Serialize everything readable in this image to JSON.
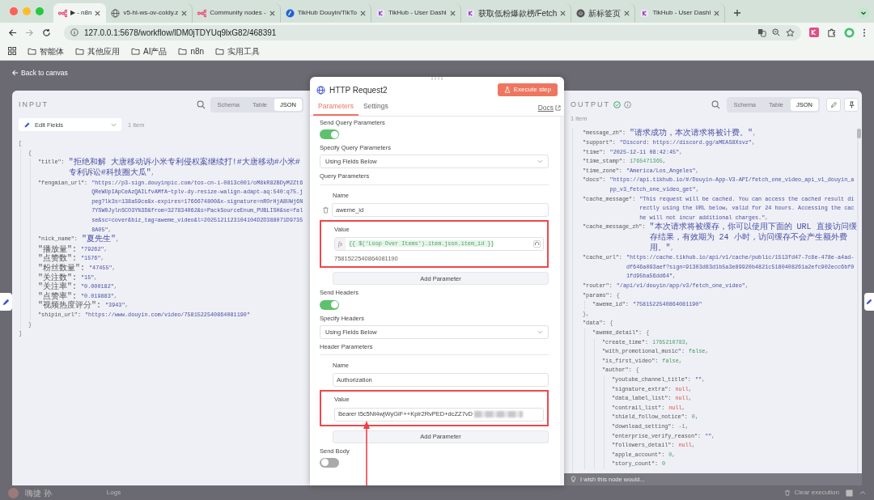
{
  "browser": {
    "tabs": [
      {
        "title": "▶ - n8n",
        "kind": "n8n",
        "selected": true
      },
      {
        "title": "v5-hl-ws-ov-coldy.z",
        "kind": "globe",
        "selected": false
      },
      {
        "title": "Community nodes -",
        "kind": "n8n",
        "selected": false
      },
      {
        "title": "TikHub Douyin/TikTo",
        "kind": "tikhub",
        "selected": false
      },
      {
        "title": "TikHub - User Dashl",
        "kind": "k",
        "selected": false
      },
      {
        "title": "获取低粉爆款榜/Fetch",
        "kind": "k",
        "selected": false
      },
      {
        "title": "新标签页",
        "kind": "chrome",
        "selected": false
      },
      {
        "title": "TikHub - User Dashl",
        "kind": "k",
        "selected": false
      }
    ],
    "address": "127.0.0.1:5678/workflow/lDM0jTDYUq9lxG82/468391",
    "bookmarks": [
      "智能体",
      "其他应用",
      "AI产品",
      "n8n",
      "实用工具"
    ]
  },
  "back_link": "Back to canvas",
  "input_panel": {
    "title": "INPUT",
    "view_tabs": [
      {
        "label": "Schema",
        "selected": false
      },
      {
        "label": "Table",
        "selected": false
      },
      {
        "label": "JSON",
        "selected": true
      }
    ],
    "source": "Edit Fields",
    "item_count": "1 item",
    "json": [
      {
        "open": "[",
        "close": "]",
        "children": [
          {
            "open": "{",
            "close": "}",
            "children": [
              {
                "key": "\"title\":",
                "value": "\"拒绝和解 大唐移动诉小米专利侵权案继续打!#大唐移动#小米#专利诉讼#科技圈大瓜\"",
                "kind": "string",
                "sep": ","
              },
              {
                "key": "\"fengmian_url\":",
                "value": "\"https://p3-sign.douyinpic.com/tos-cn-i-0813c001/oM8kR82BDyM2Zt6QReWUpIApCeAzQAILfvAMfA~tplv-dy-resize-walign-adapt-aq:540:q75.jpeg?lk3s=138a59ce&x-expires=1766674800&x-signature=nROrHjA8UWj6N7YSW0JylnSCO3Y%3D&from=327834062&s=PackSourceEnum_PUBLISH&se=false&sc=cover&biz_tag=aweme_video&l=2025121123104104D2D388071D97358A05\"",
                "kind": "string",
                "sep": ","
              },
              {
                "key": "\"nick_name\":",
                "value": "\"夏先生\"",
                "kind": "string",
                "sep": ","
              },
              {
                "key": "\"播放量\":",
                "value": "\"79262\"",
                "kind": "string",
                "sep": ","
              },
              {
                "key": "\"点赞数\":",
                "value": "\"1576\"",
                "kind": "string",
                "sep": ","
              },
              {
                "key": "\"粉丝数量\":",
                "value": "\"47455\"",
                "kind": "string",
                "sep": ","
              },
              {
                "key": "\"关注数\":",
                "value": "\"15\"",
                "kind": "string",
                "sep": ","
              },
              {
                "key": "\"关注率\":",
                "value": "\"0.000182\"",
                "kind": "string",
                "sep": ","
              },
              {
                "key": "\"点赞率\":",
                "value": "\"0.019883\"",
                "kind": "string",
                "sep": ","
              },
              {
                "key": "\"视频热度评分\":",
                "value": "\"3943\"",
                "kind": "string",
                "sep": ","
              },
              {
                "key": "\"shipin_url\":",
                "value": "\"https://www.douyin.com/video/7581522540864081190\"",
                "kind": "string"
              }
            ]
          }
        ]
      }
    ]
  },
  "node_panel": {
    "title": "HTTP Request2",
    "execute_button": "Execute step",
    "tabs": [
      {
        "label": "Parameters",
        "selected": true
      },
      {
        "label": "Settings",
        "selected": false
      }
    ],
    "docs": "Docs",
    "sections": [
      {
        "kind": "toggle",
        "label": "Send Query Parameters",
        "on": true
      },
      {
        "kind": "select",
        "label": "Specify Query Parameters",
        "value": "Using Fields Below"
      },
      {
        "kind": "params",
        "title": "Query Parameters",
        "name_label": "Name",
        "name": "aweme_id",
        "deletable": true,
        "value_label": "Value",
        "value_field": {
          "kind": "expression",
          "fx": "fx",
          "text": "{{ $('Loop Over Items').item.json.item_id }}",
          "result": "7581522540864081190"
        },
        "highlighted": true,
        "add_label": "Add Parameter"
      },
      {
        "kind": "toggle",
        "label": "Send Headers",
        "on": true
      },
      {
        "kind": "select",
        "label": "Specify Headers",
        "value": "Using Fields Below"
      },
      {
        "kind": "params",
        "title": "Header Parameters",
        "name_label": "Name",
        "name": "Authorization",
        "deletable": false,
        "value_label": "Value",
        "value_field": {
          "kind": "text",
          "text": "Bearer t5c5Nt4wjWyGiF++Kpir2RvPED+dcZZ7vD",
          "blurred": true
        },
        "highlighted": true,
        "arrow": true,
        "add_label": "Add Parameter"
      },
      {
        "kind": "toggle",
        "label": "Send Body",
        "on": false
      }
    ]
  },
  "output_panel": {
    "title": "OUTPUT",
    "success": true,
    "view_tabs": [
      {
        "label": "Schema",
        "selected": false
      },
      {
        "label": "Table",
        "selected": false
      },
      {
        "label": "JSON",
        "selected": true
      }
    ],
    "item_count": "1 item",
    "json": [
      {
        "key": "\"message_zh\":",
        "value": "\"请求成功，本次请求将被计费。\"",
        "kind": "string",
        "sep": ","
      },
      {
        "key": "\"support\":",
        "value": "\"Discord: https://discord.gg/aMEAS8Xsvz\"",
        "kind": "string",
        "sep": ","
      },
      {
        "key": "\"time\":",
        "value": "\"2025-12-11 08:42:45\"",
        "kind": "string",
        "sep": ","
      },
      {
        "key": "\"time_stamp\":",
        "value": "1765471365",
        "kind": "number",
        "sep": ","
      },
      {
        "key": "\"time_zone\":",
        "value": "\"America/Los_Angeles\"",
        "kind": "string",
        "sep": ","
      },
      {
        "key": "\"docs\":",
        "value": "\"https://api.tikhub.io/#/Douyin-App-V3-API/fetch_one_video_api_v1_douyin_app_v3_fetch_one_video_get\"",
        "kind": "string",
        "sep": ","
      },
      {
        "key": "\"cache_message\":",
        "value": "\"This request will be cached. You can access the cached result directly using the URL below, valid for 24 hours. Accessing the cache will not incur additional charges.\"",
        "kind": "string",
        "sep": ","
      },
      {
        "key": "\"cache_message_zh\":",
        "value": "\"本次请求将被缓存，你可以使用下面的 URL 直接访问缓存结果，有效期为 24 小时，访问缓存不会产生额外费用。\"",
        "kind": "string",
        "sep": ","
      },
      {
        "key": "\"cache_url\":",
        "value": "\"https://cache.tikhub.io/api/v1/cache/public/1513fd47-7c8e-478e-a4ad-df646a093aef?sign=91303d83d1b5a3e89920b4821c5180408261a2efc902ecc6bf01fd95ba56dd64\"",
        "kind": "string",
        "sep": ","
      },
      {
        "key": "\"router\":",
        "value": "\"/api/v1/douyin/app/v3/fetch_one_video\"",
        "kind": "string",
        "sep": ","
      },
      {
        "key": "\"params\":",
        "open": "{",
        "close": "},",
        "children": [
          {
            "key": "\"aweme_id\":",
            "value": "\"7581522540864081190\"",
            "kind": "string"
          }
        ]
      },
      {
        "key": "\"data\":",
        "open": "{",
        "children": [
          {
            "key": "\"aweme_detail\":",
            "open": "{",
            "children": [
              {
                "key": "\"create_time\":",
                "value": "1765210783",
                "kind": "number",
                "sep": ","
              },
              {
                "key": "\"with_promotional_music\":",
                "value": "false",
                "kind": "bool",
                "sep": ","
              },
              {
                "key": "\"is_first_video\":",
                "value": "false",
                "kind": "bool",
                "sep": ","
              },
              {
                "key": "\"author\":",
                "open": "{",
                "children": [
                  {
                    "key": "\"youtube_channel_title\":",
                    "value": "\"\"",
                    "kind": "string",
                    "sep": ","
                  },
                  {
                    "key": "\"signature_extra\":",
                    "value": "null",
                    "kind": "null",
                    "sep": ","
                  },
                  {
                    "key": "\"data_label_list\":",
                    "value": "null",
                    "kind": "null",
                    "sep": ","
                  },
                  {
                    "key": "\"contrail_list\":",
                    "value": "null",
                    "kind": "null",
                    "sep": ","
                  },
                  {
                    "key": "\"shield_follow_notice\":",
                    "value": "0",
                    "kind": "number",
                    "sep": ","
                  },
                  {
                    "key": "\"download_setting\":",
                    "value": "-1",
                    "kind": "number",
                    "sep": ","
                  },
                  {
                    "key": "\"enterprise_verify_reason\":",
                    "value": "\"\"",
                    "kind": "string",
                    "sep": ","
                  },
                  {
                    "key": "\"followers_detail\":",
                    "value": "null",
                    "kind": "null",
                    "sep": ","
                  },
                  {
                    "key": "\"apple_account\":",
                    "value": "0",
                    "kind": "number",
                    "sep": ","
                  },
                  {
                    "key": "\"story_count\":",
                    "value": "0",
                    "kind": "number"
                  }
                ]
              }
            ]
          }
        ]
      }
    ],
    "feedback_placeholder": "I wish this node would..."
  },
  "footer": {
    "user": "嗨捷 孙",
    "logs": "Logs",
    "clear": "Clear execution"
  }
}
